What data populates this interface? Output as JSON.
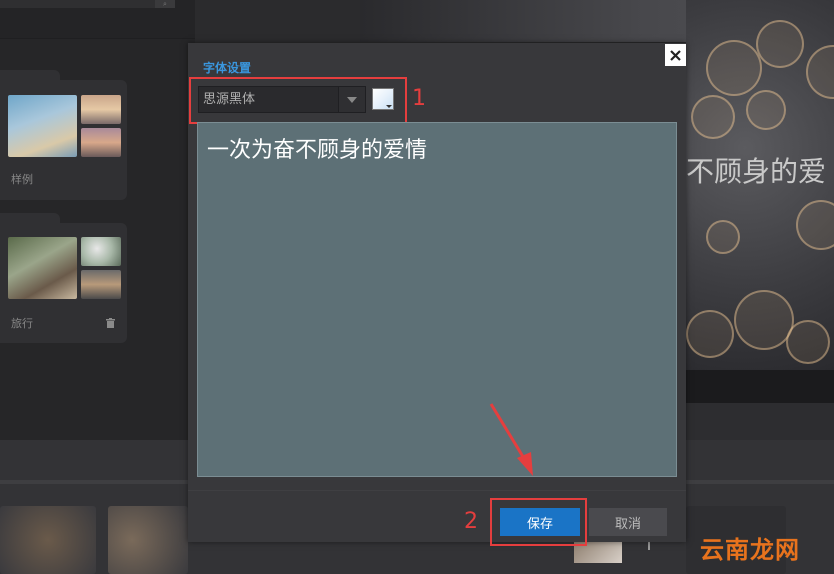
{
  "albums": [
    {
      "label": "样例"
    },
    {
      "label": "旅行"
    }
  ],
  "preview": {
    "text": "不顾身的爱"
  },
  "dialog": {
    "title": "字体设置",
    "font_select": {
      "value": "思源黑体"
    },
    "text_content": "一次为奋不顾身的爱情",
    "save_label": "保存",
    "cancel_label": "取消"
  },
  "annotations": {
    "step1": "1",
    "step2": "2"
  },
  "watermark": "云南龙网",
  "colors": {
    "accent": "#1a74c6",
    "title_blue": "#3a96dd",
    "annotation_red": "#e53e3e",
    "text_area_bg": "#5d7076",
    "watermark": "#e8731d"
  }
}
